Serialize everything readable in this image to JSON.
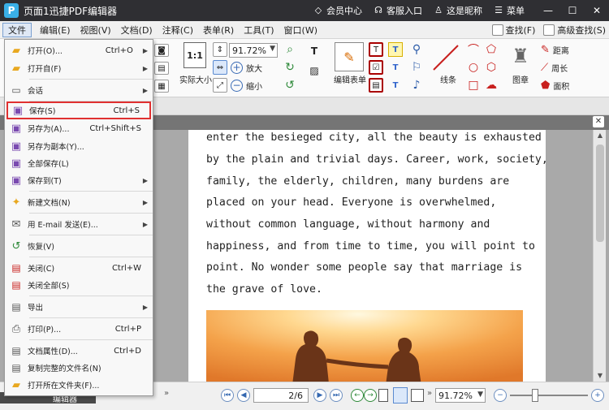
{
  "titlebar": {
    "app_title": "页面1迅捷PDF编辑器",
    "links": [
      {
        "icon": "diamond-icon",
        "label": "会员中心"
      },
      {
        "icon": "headset-icon",
        "label": "客服入口"
      },
      {
        "icon": "user-icon",
        "label": "这是昵称"
      },
      {
        "icon": "list-icon",
        "label": "菜单"
      }
    ],
    "logo_letter": "P"
  },
  "menubar": {
    "items": [
      "文件",
      "编辑(E)",
      "视图(V)",
      "文档(D)",
      "注释(C)",
      "表单(R)",
      "工具(T)",
      "窗口(W)"
    ],
    "active_index": 0,
    "right": [
      {
        "icon": "search-icon",
        "label": "查找(F)"
      },
      {
        "icon": "advanced-search-icon",
        "label": "高级查找(S)"
      }
    ]
  },
  "ribbon": {
    "zoom_value": "91.72%",
    "zoom_in": "放大",
    "zoom_out": "缩小",
    "actual_size": "实际大小",
    "edit_form": "编辑表单",
    "lines": "线条",
    "stamp": "图章",
    "distance": "距离",
    "perimeter": "周长",
    "area": "面积",
    "ratio_label": "1:1"
  },
  "file_menu": {
    "items": [
      {
        "label": "打开(O)...",
        "shortcut": "Ctrl+O",
        "submenu": true,
        "icon": "folder-open-icon"
      },
      {
        "label": "打开自(F)",
        "shortcut": "",
        "submenu": true,
        "icon": "folder-globe-icon"
      },
      {
        "label": "会话",
        "shortcut": "",
        "submenu": true,
        "icon": "session-icon"
      },
      {
        "label": "保存(S)",
        "shortcut": "Ctrl+S",
        "submenu": false,
        "icon": "save-icon",
        "highlighted": true
      },
      {
        "label": "另存为(A)...",
        "shortcut": "Ctrl+Shift+S",
        "submenu": false,
        "icon": "save-as-icon"
      },
      {
        "label": "另存为副本(Y)...",
        "shortcut": "",
        "submenu": false,
        "icon": "save-copy-icon"
      },
      {
        "label": "全部保存(L)",
        "shortcut": "",
        "submenu": false,
        "icon": "save-all-icon"
      },
      {
        "label": "保存到(T)",
        "shortcut": "",
        "submenu": true,
        "icon": "save-to-icon"
      },
      {
        "label": "新建文档(N)",
        "shortcut": "",
        "submenu": true,
        "icon": "new-document-icon"
      },
      {
        "label": "用 E-mail 发送(E)...",
        "shortcut": "",
        "submenu": true,
        "icon": "email-icon"
      },
      {
        "label": "恢复(V)",
        "shortcut": "",
        "submenu": false,
        "icon": "restore-icon"
      },
      {
        "label": "关闭(C)",
        "shortcut": "Ctrl+W",
        "submenu": false,
        "icon": "close-doc-icon"
      },
      {
        "label": "关闭全部(S)",
        "shortcut": "",
        "submenu": false,
        "icon": "close-all-icon"
      },
      {
        "label": "导出",
        "shortcut": "",
        "submenu": true,
        "icon": "export-icon"
      },
      {
        "label": "打印(P)...",
        "shortcut": "Ctrl+P",
        "submenu": false,
        "icon": "print-icon"
      },
      {
        "label": "文档属性(D)...",
        "shortcut": "Ctrl+D",
        "submenu": false,
        "icon": "doc-properties-icon"
      },
      {
        "label": "复制完整的文件名(N)",
        "shortcut": "",
        "submenu": false,
        "icon": "copy-filename-icon"
      },
      {
        "label": "打开所在文件夹(F)...",
        "shortcut": "",
        "submenu": false,
        "icon": "open-folder-icon"
      }
    ]
  },
  "document": {
    "lines": [
      "enter the besieged city, all the beauty is exhausted",
      "by the plain and trivial days. Career, work, society,",
      "family,  the  elderly,  children,  many  burdens  are",
      "placed  on  your  head.  Everyone  is  overwhelmed,",
      "without  common  language,  without  harmony  and",
      "happiness, and from time to time, you will point to",
      "point. No wonder some people say that marriage is",
      "the grave of love."
    ]
  },
  "statusbar": {
    "page_indicator": "2/6",
    "zoom_value": "91.72%",
    "bottom_tab": "编辑器"
  }
}
